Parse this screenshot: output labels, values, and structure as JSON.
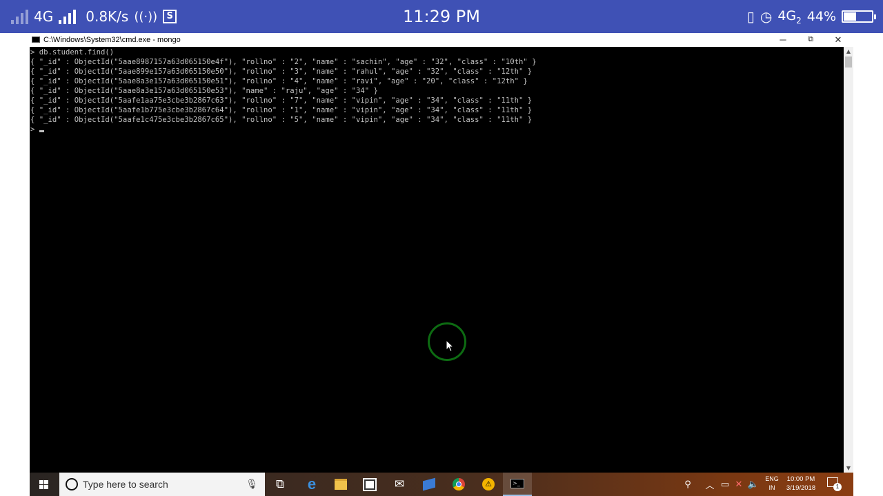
{
  "status_bar": {
    "network_left": "4G",
    "speed": "0.8K/s",
    "time": "11:29 PM",
    "network_right": "4G",
    "network_right_sub": "2",
    "battery_percent": "44%",
    "battery_level": 0.44,
    "icons": [
      "signal-icon-faded",
      "signal-icon",
      "hotspot-icon",
      "s-app-icon",
      "vibrate-icon",
      "alarm-icon",
      "battery-icon"
    ]
  },
  "window": {
    "title": "C:\\Windows\\System32\\cmd.exe - mongo",
    "minimize": "─",
    "maximize": "⧉",
    "close": "✕"
  },
  "console": {
    "lines": [
      "> db.student.find()",
      "{ \"_id\" : ObjectId(\"5aae8987157a63d065150e4f\"), \"rollno\" : \"2\", \"name\" : \"sachin\", \"age\" : \"32\", \"class\" : \"10th\" }",
      "{ \"_id\" : ObjectId(\"5aae899e157a63d065150e50\"), \"rollno\" : \"3\", \"name\" : \"rahul\", \"age\" : \"32\", \"class\" : \"12th\" }",
      "{ \"_id\" : ObjectId(\"5aae8a3e157a63d065150e51\"), \"rollno\" : \"4\", \"name\" : \"ravi\", \"age\" : \"20\", \"class\" : \"12th\" }",
      "{ \"_id\" : ObjectId(\"5aae8a3e157a63d065150e53\"), \"name\" : \"raju\", \"age\" : \"34\" }",
      "{ \"_id\" : ObjectId(\"5aafe1aa75e3cbe3b2867c63\"), \"rollno\" : \"7\", \"name\" : \"vipin\", \"age\" : \"34\", \"class\" : \"11th\" }",
      "{ \"_id\" : ObjectId(\"5aafe1b775e3cbe3b2867c64\"), \"rollno\" : \"1\", \"name\" : \"vipin\", \"age\" : \"34\", \"class\" : \"11th\" }",
      "{ \"_id\" : ObjectId(\"5aafe1c475e3cbe3b2867c65\"), \"rollno\" : \"5\", \"name\" : \"vipin\", \"age\" : \"34\", \"class\" : \"11th\" }"
    ],
    "prompt": "> "
  },
  "taskbar": {
    "search_placeholder": "Type here to search",
    "lang_top": "ENG",
    "lang_bottom": "IN",
    "clock_time": "10:00 PM",
    "clock_date": "3/19/2018",
    "notification_count": "1",
    "pinned": [
      "task-view-icon",
      "edge-icon",
      "file-explorer-icon",
      "store-icon",
      "mail-icon",
      "app-icon",
      "chrome-icon",
      "warning-app-icon",
      "cmd-icon"
    ]
  }
}
